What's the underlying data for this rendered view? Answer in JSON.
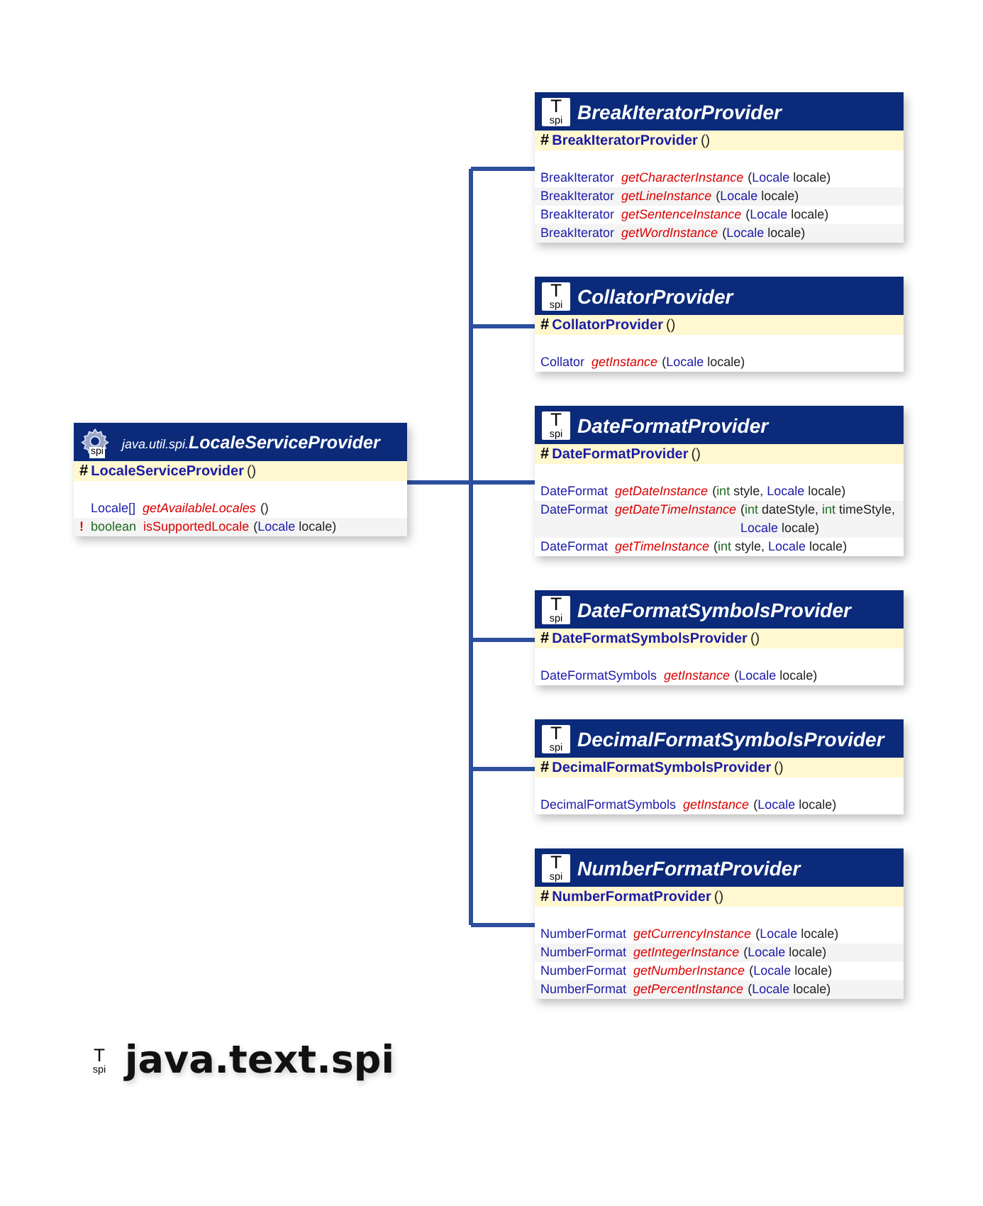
{
  "superclass": {
    "icon": {
      "label": "spi"
    },
    "package": "java.util.spi.",
    "name": "LocaleServiceProvider",
    "constructor": {
      "visibility": "#",
      "name": "LocaleServiceProvider",
      "params": "()"
    },
    "methods": [
      {
        "return_type": "Locale[]",
        "primitive": false,
        "name": "getAvailableLocales",
        "abstract": true,
        "params": [
          {
            "text": "()",
            "kind": "plain"
          }
        ]
      },
      {
        "marker": "!",
        "return_type": "boolean",
        "primitive": true,
        "name": "isSupportedLocale",
        "abstract": false,
        "params": [
          {
            "text": "(",
            "kind": "plain"
          },
          {
            "text": "Locale",
            "kind": "class"
          },
          {
            "text": " locale)",
            "kind": "plain"
          }
        ]
      }
    ]
  },
  "subclasses": [
    {
      "icon": {
        "glyph": "T",
        "label": "spi"
      },
      "name": "BreakIteratorProvider",
      "constructor": {
        "visibility": "#",
        "name": "BreakIteratorProvider",
        "params": "()"
      },
      "methods": [
        {
          "return_type": "BreakIterator",
          "primitive": false,
          "name": "getCharacterInstance",
          "abstract": true,
          "params": [
            {
              "text": "(",
              "kind": "plain"
            },
            {
              "text": "Locale",
              "kind": "class"
            },
            {
              "text": " locale)",
              "kind": "plain"
            }
          ]
        },
        {
          "return_type": "BreakIterator",
          "primitive": false,
          "name": "getLineInstance",
          "abstract": true,
          "params": [
            {
              "text": "(",
              "kind": "plain"
            },
            {
              "text": "Locale",
              "kind": "class"
            },
            {
              "text": " locale)",
              "kind": "plain"
            }
          ]
        },
        {
          "return_type": "BreakIterator",
          "primitive": false,
          "name": "getSentenceInstance",
          "abstract": true,
          "params": [
            {
              "text": "(",
              "kind": "plain"
            },
            {
              "text": "Locale",
              "kind": "class"
            },
            {
              "text": " locale)",
              "kind": "plain"
            }
          ]
        },
        {
          "return_type": "BreakIterator",
          "primitive": false,
          "name": "getWordInstance",
          "abstract": true,
          "params": [
            {
              "text": "(",
              "kind": "plain"
            },
            {
              "text": "Locale",
              "kind": "class"
            },
            {
              "text": " locale)",
              "kind": "plain"
            }
          ]
        }
      ]
    },
    {
      "icon": {
        "glyph": "T",
        "label": "spi"
      },
      "name": "CollatorProvider",
      "constructor": {
        "visibility": "#",
        "name": "CollatorProvider",
        "params": "()"
      },
      "methods": [
        {
          "return_type": "Collator",
          "primitive": false,
          "name": "getInstance",
          "abstract": true,
          "params": [
            {
              "text": "(",
              "kind": "plain"
            },
            {
              "text": "Locale",
              "kind": "class"
            },
            {
              "text": " locale)",
              "kind": "plain"
            }
          ]
        }
      ]
    },
    {
      "icon": {
        "glyph": "T",
        "label": "spi"
      },
      "name": "DateFormatProvider",
      "constructor": {
        "visibility": "#",
        "name": "DateFormatProvider",
        "params": "()"
      },
      "methods": [
        {
          "return_type": "DateFormat",
          "primitive": false,
          "name": "getDateInstance",
          "abstract": true,
          "params": [
            {
              "text": "(",
              "kind": "plain"
            },
            {
              "text": "int",
              "kind": "primitive"
            },
            {
              "text": " style, ",
              "kind": "plain"
            },
            {
              "text": "Locale",
              "kind": "class"
            },
            {
              "text": " locale)",
              "kind": "plain"
            }
          ]
        },
        {
          "return_type": "DateFormat",
          "primitive": false,
          "name": "getDateTimeInstance",
          "abstract": true,
          "params": [
            {
              "text": "(",
              "kind": "plain"
            },
            {
              "text": "int",
              "kind": "primitive"
            },
            {
              "text": " dateStyle, ",
              "kind": "plain"
            },
            {
              "text": "int",
              "kind": "primitive"
            },
            {
              "text": " timeStyle, ",
              "kind": "plain"
            },
            {
              "text": "Locale",
              "kind": "class"
            },
            {
              "text": " locale)",
              "kind": "plain"
            }
          ]
        },
        {
          "return_type": "DateFormat",
          "primitive": false,
          "name": "getTimeInstance",
          "abstract": true,
          "params": [
            {
              "text": "(",
              "kind": "plain"
            },
            {
              "text": "int",
              "kind": "primitive"
            },
            {
              "text": " style, ",
              "kind": "plain"
            },
            {
              "text": "Locale",
              "kind": "class"
            },
            {
              "text": " locale)",
              "kind": "plain"
            }
          ]
        }
      ]
    },
    {
      "icon": {
        "glyph": "T",
        "label": "spi"
      },
      "name": "DateFormatSymbolsProvider",
      "constructor": {
        "visibility": "#",
        "name": "DateFormatSymbolsProvider",
        "params": "()"
      },
      "methods": [
        {
          "return_type": "DateFormatSymbols",
          "primitive": false,
          "name": "getInstance",
          "abstract": true,
          "params": [
            {
              "text": "(",
              "kind": "plain"
            },
            {
              "text": "Locale",
              "kind": "class"
            },
            {
              "text": " locale)",
              "kind": "plain"
            }
          ]
        }
      ]
    },
    {
      "icon": {
        "glyph": "T",
        "label": "spi"
      },
      "name": "DecimalFormatSymbolsProvider",
      "constructor": {
        "visibility": "#",
        "name": "DecimalFormatSymbolsProvider",
        "params": "()"
      },
      "methods": [
        {
          "return_type": "DecimalFormatSymbols",
          "primitive": false,
          "name": "getInstance",
          "abstract": true,
          "params": [
            {
              "text": "(",
              "kind": "plain"
            },
            {
              "text": "Locale",
              "kind": "class"
            },
            {
              "text": " locale)",
              "kind": "plain"
            }
          ]
        }
      ]
    },
    {
      "icon": {
        "glyph": "T",
        "label": "spi"
      },
      "name": "NumberFormatProvider",
      "constructor": {
        "visibility": "#",
        "name": "NumberFormatProvider",
        "params": "()"
      },
      "methods": [
        {
          "return_type": "NumberFormat",
          "primitive": false,
          "name": "getCurrencyInstance",
          "abstract": true,
          "params": [
            {
              "text": "(",
              "kind": "plain"
            },
            {
              "text": "Locale",
              "kind": "class"
            },
            {
              "text": " locale)",
              "kind": "plain"
            }
          ]
        },
        {
          "return_type": "NumberFormat",
          "primitive": false,
          "name": "getIntegerInstance",
          "abstract": true,
          "params": [
            {
              "text": "(",
              "kind": "plain"
            },
            {
              "text": "Locale",
              "kind": "class"
            },
            {
              "text": " locale)",
              "kind": "plain"
            }
          ]
        },
        {
          "return_type": "NumberFormat",
          "primitive": false,
          "name": "getNumberInstance",
          "abstract": true,
          "params": [
            {
              "text": "(",
              "kind": "plain"
            },
            {
              "text": "Locale",
              "kind": "class"
            },
            {
              "text": " locale)",
              "kind": "plain"
            }
          ]
        },
        {
          "return_type": "NumberFormat",
          "primitive": false,
          "name": "getPercentInstance",
          "abstract": true,
          "params": [
            {
              "text": "(",
              "kind": "plain"
            },
            {
              "text": "Locale",
              "kind": "class"
            },
            {
              "text": " locale)",
              "kind": "plain"
            }
          ]
        }
      ]
    }
  ],
  "package_title": {
    "icon": {
      "glyph": "T",
      "label": "spi"
    },
    "text": "java.text.spi"
  }
}
